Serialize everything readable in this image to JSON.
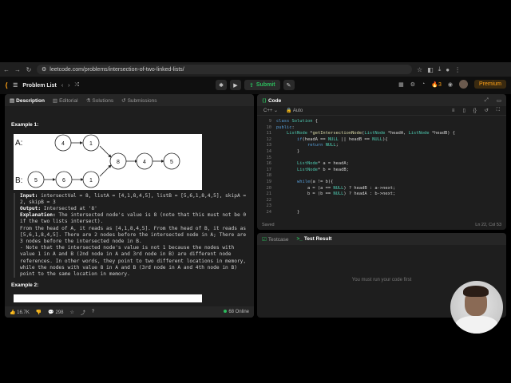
{
  "browser": {
    "url": "leetcode.com/problems/intersection-of-two-linked-lists/"
  },
  "topbar": {
    "problem_list": "Problem List",
    "submit": "Submit",
    "streak": "3",
    "premium": "Premium"
  },
  "desc": {
    "tabs": [
      "Description",
      "Editorial",
      "Solutions",
      "Submissions"
    ],
    "example1_title": "Example 1:",
    "figure": {
      "labelA": "A:",
      "labelB": "B:",
      "listA": [
        "4",
        "1"
      ],
      "listB": [
        "5",
        "6",
        "1"
      ],
      "common": [
        "8",
        "4",
        "5"
      ]
    },
    "input_label": "Input:",
    "input_text": " intersectVal = 8, listA = [4,1,8,4,5], listB = [5,6,1,8,4,5], skipA = 2, skipB = 3",
    "output_label": "Output:",
    "output_text": " Intersected at '8'",
    "explanation_label": "Explanation:",
    "explanation_text": " The intersected node's value is 8 (note that this must not be 0 if the two lists intersect).",
    "explanation_2": "From the head of A, it reads as [4,1,8,4,5]. From the head of B, it reads as [5,6,1,8,4,5]. There are 2 nodes before the intersected node in A; There are 3 nodes before the intersected node in B.",
    "explanation_3": "- Note that the intersected node's value is not 1 because the nodes with value 1 in A and B (2nd node in A and 3rd node in B) are different node references. In other words, they point to two different locations in memory, while the nodes with value 8 in A and B (3rd node in A and 4th node in B) point to the same location in memory.",
    "example2_title": "Example 2:",
    "likes": "16.7K",
    "comments": "298",
    "online": "68 Online"
  },
  "code": {
    "title": "Code",
    "lang": "C++",
    "auto": "Auto",
    "lines": [
      {
        "n": "9",
        "t": "class Solution {"
      },
      {
        "n": "10",
        "t": "public:"
      },
      {
        "n": "11",
        "t": "    ListNode *getIntersectionNode(ListNode *headA, ListNode *headB) {"
      },
      {
        "n": "12",
        "t": "        if(headA == NULL || headB == NULL){"
      },
      {
        "n": "13",
        "t": "            return NULL;"
      },
      {
        "n": "14",
        "t": "        }"
      },
      {
        "n": "15",
        "t": ""
      },
      {
        "n": "16",
        "t": "        ListNode* a = headA;"
      },
      {
        "n": "17",
        "t": "        ListNode* b = headB;"
      },
      {
        "n": "18",
        "t": ""
      },
      {
        "n": "19",
        "t": "        while(a != b){"
      },
      {
        "n": "20",
        "t": "            a = (a == NULL) ? headB : a->next;"
      },
      {
        "n": "21",
        "t": "            b = (b == NULL) ? headA : b->next;"
      },
      {
        "n": "22",
        "t": ""
      },
      {
        "n": "23",
        "t": ""
      },
      {
        "n": "24",
        "t": "        }"
      }
    ],
    "saved": "Saved",
    "cursor": "Ln 22, Col 53"
  },
  "test": {
    "tabs": [
      "Testcase",
      "Test Result"
    ],
    "empty": "You must run your code first"
  }
}
